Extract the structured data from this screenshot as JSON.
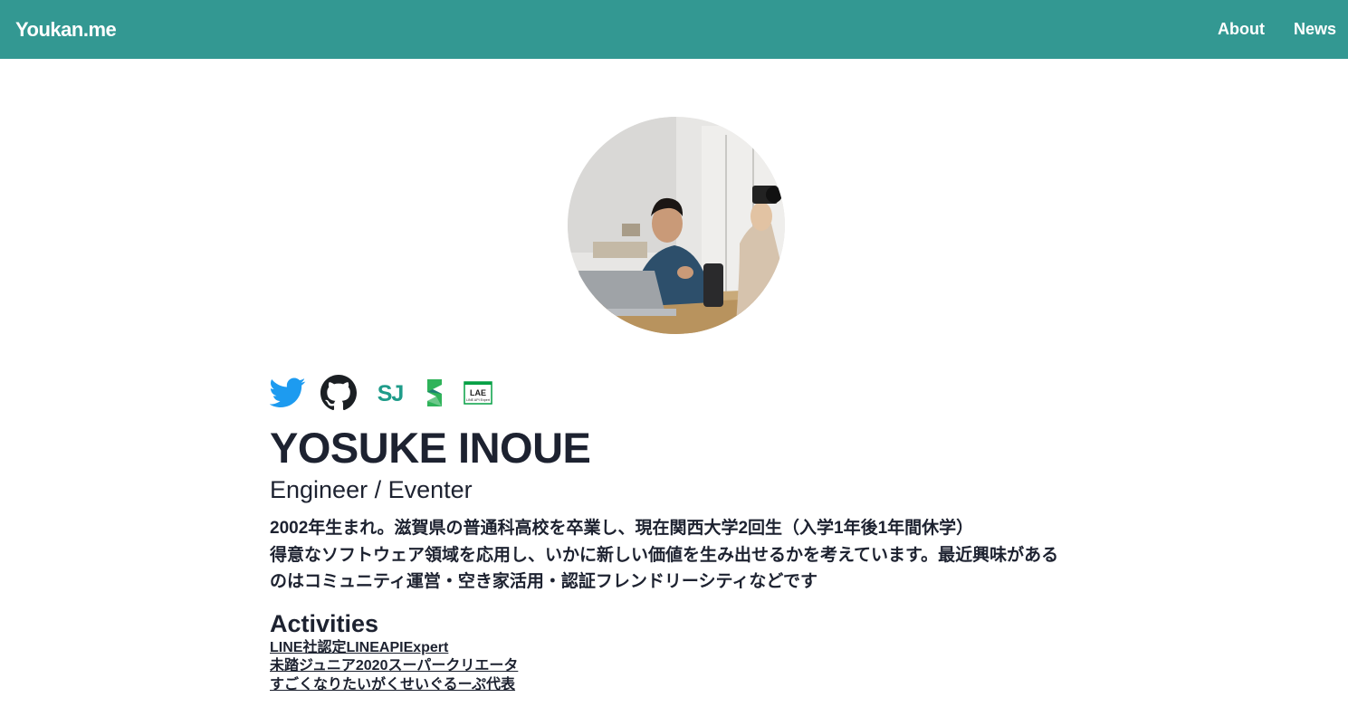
{
  "navbar": {
    "brand": "Youkan.me",
    "links": [
      {
        "label": "About"
      },
      {
        "label": "News"
      }
    ]
  },
  "profile": {
    "name": "YOSUKE INOUE",
    "role": "Engineer / Eventer",
    "bio_lines": [
      "2002年生まれ。滋賀県の普通科高校を卒業し、現在関西大学2回生（入学1年後1年間休学）",
      "得意なソフトウェア領域を応用し、いかに新しい価値を生み出せるかを考えています。最近興味がある",
      "のはコミュニティ運営・空き家活用・認証フレンドリーシティなどです"
    ]
  },
  "social_icons": [
    {
      "name": "twitter-icon"
    },
    {
      "name": "github-icon"
    },
    {
      "name": "sj-icon",
      "text": "SJ"
    },
    {
      "name": "s-logo-icon"
    },
    {
      "name": "line-api-expert-icon",
      "text": "LAE",
      "subtext": "LINE API Expert"
    }
  ],
  "activities": {
    "title": "Activities",
    "items": [
      "LINE社認定LINEAPIExpert",
      "未踏ジュニア2020スーパークリエータ",
      "すごくなりたいがくせいぐるーぷ代表"
    ]
  },
  "colors": {
    "navbar_bg": "#339892",
    "text": "#1d2230",
    "twitter": "#1d9bf0",
    "sj": "#1f9c8a"
  }
}
